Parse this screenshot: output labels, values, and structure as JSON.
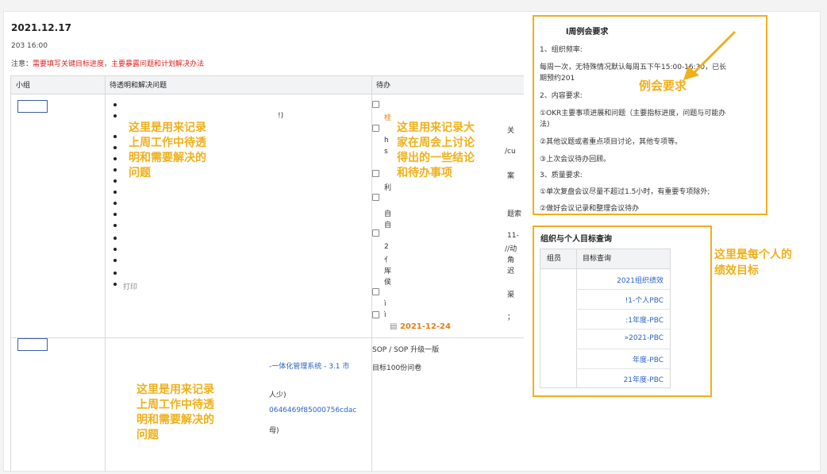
{
  "header": {
    "date": "2021.12.17",
    "time": "203 16:00",
    "note_prefix": "注意：",
    "note_red": "需要填写关键目标进度，主要暴露问题和计划解决办法"
  },
  "table": {
    "columns": [
      "小组",
      "待透明和解决问题",
      "待办"
    ],
    "row1": {
      "issues_fragments": [
        "!)",
        "打印"
      ],
      "todo_fragments": [
        "关",
        "/cu",
        "案",
        "题索",
        "11-",
        "//动",
        "角",
        "迟",
        "渠",
        "；",
        "桂",
        "h",
        "s",
        "利",
        "自",
        "自",
        "2",
        "亻",
        "厍",
        "侯",
        "ì",
        "ì"
      ],
      "date_chip": "2021-12-24"
    },
    "row2": {
      "issue_links": [
        "-一体化管理系统 - 3.1 市",
        "0646469f85000756cdac"
      ],
      "issue_fragments": [
        "人少)",
        "母)"
      ],
      "todo_items": [
        "SOP / SOP 升级一版",
        "目标100份问卷"
      ]
    }
  },
  "annotations": {
    "issues_overlay_1": [
      "这里是用来记录",
      "上周工作中待透",
      "明和需要解决的",
      "问题"
    ],
    "todo_overlay": [
      "这里用来记录大",
      "家在周会上讨论",
      "得出的一些结论",
      "和待办事项"
    ],
    "issues_overlay_2": [
      "这里是用来记录",
      "上周工作中待透",
      "明和需要解决的",
      "问题"
    ],
    "meeting_overlay": "例会要求",
    "goals_overlay": [
      "这里是每个人的",
      "绩效目标"
    ]
  },
  "meeting_panel": {
    "title": "l周例会要求",
    "lines": [
      "1、组织频率:",
      "每周一次，无特殊情况默认每周五下午15:00-16:30，已长",
      "期预约201",
      "2、内容要求:",
      "①OKR主要事项进展和问题（主要指标进度，问题与可能办",
      "法)",
      "②其他议题或者重点项目讨论，其他专项等。",
      "③上次会议待办回顾。",
      "3、质量要求:",
      "①单次复盘会议尽量不超过1.5小时，有重要专项除外;",
      "②做好会议记录和整理会议待办"
    ]
  },
  "goals_panel": {
    "title": "组织与个人目标查询",
    "columns": [
      "组员",
      "目标查询"
    ],
    "links": [
      "2021组织绩效",
      "!1-个人PBC",
      ":1年度-PBC",
      "»2021-PBC",
      "年度-PBC",
      "21年度-PBC"
    ]
  },
  "colors": {
    "accent_yellow": "#f0b01a",
    "link_blue": "#2a62c9",
    "note_red": "#e02020",
    "date_orange": "#e0801a"
  }
}
